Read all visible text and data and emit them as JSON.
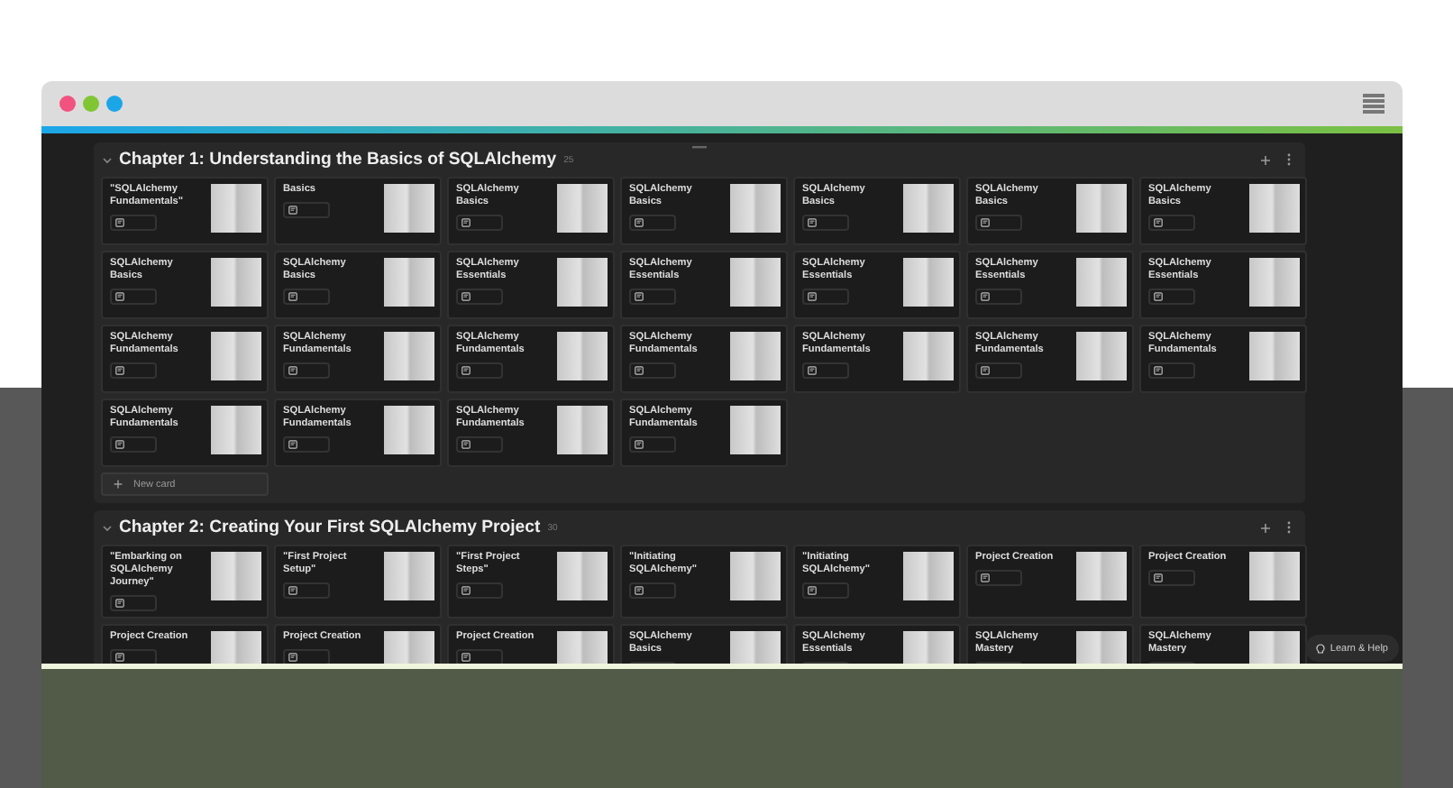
{
  "chapters": [
    {
      "title": "Chapter 1: Understanding the Basics of SQLAlchemy",
      "count": "25",
      "new_card": "New card",
      "cards": [
        {
          "title": "\"SQLAlchemy Fundamentals\""
        },
        {
          "title": "Basics"
        },
        {
          "title": "SQLAlchemy Basics"
        },
        {
          "title": "SQLAlchemy Basics"
        },
        {
          "title": "SQLAlchemy Basics"
        },
        {
          "title": "SQLAlchemy Basics"
        },
        {
          "title": "SQLAlchemy Basics"
        },
        {
          "title": "SQLAlchemy Basics"
        },
        {
          "title": "SQLAlchemy Basics"
        },
        {
          "title": "SQLAlchemy Essentials"
        },
        {
          "title": "SQLAlchemy Essentials"
        },
        {
          "title": "SQLAlchemy Essentials"
        },
        {
          "title": "SQLAlchemy Essentials"
        },
        {
          "title": "SQLAlchemy Essentials"
        },
        {
          "title": "SQLAlchemy Fundamentals"
        },
        {
          "title": "SQLAlchemy Fundamentals"
        },
        {
          "title": "SQLAlchemy Fundamentals"
        },
        {
          "title": "SQLAlchemy Fundamentals"
        },
        {
          "title": "SQLAlchemy Fundamentals"
        },
        {
          "title": "SQLAlchemy Fundamentals"
        },
        {
          "title": "SQLAlchemy Fundamentals"
        },
        {
          "title": "SQLAlchemy Fundamentals"
        },
        {
          "title": "SQLAlchemy Fundamentals"
        },
        {
          "title": "SQLAlchemy Fundamentals"
        },
        {
          "title": "SQLAlchemy Fundamentals"
        }
      ]
    },
    {
      "title": "Chapter 2: Creating Your First SQLAlchemy Project",
      "count": "30",
      "cards": [
        {
          "title": "\"Embarking on SQLAlchemy Journey\""
        },
        {
          "title": "\"First Project Setup\""
        },
        {
          "title": "\"First Project Steps\""
        },
        {
          "title": "\"Initiating SQLAlchemy\""
        },
        {
          "title": "\"Initiating SQLAlchemy\""
        },
        {
          "title": "Project Creation"
        },
        {
          "title": "Project Creation"
        },
        {
          "title": "Project Creation"
        },
        {
          "title": "Project Creation"
        },
        {
          "title": "Project Creation"
        },
        {
          "title": "SQLAlchemy Basics"
        },
        {
          "title": "SQLAlchemy Essentials"
        },
        {
          "title": "SQLAlchemy Mastery"
        },
        {
          "title": "SQLAlchemy Mastery"
        }
      ]
    }
  ],
  "help_button": {
    "label": "Learn & Help"
  }
}
